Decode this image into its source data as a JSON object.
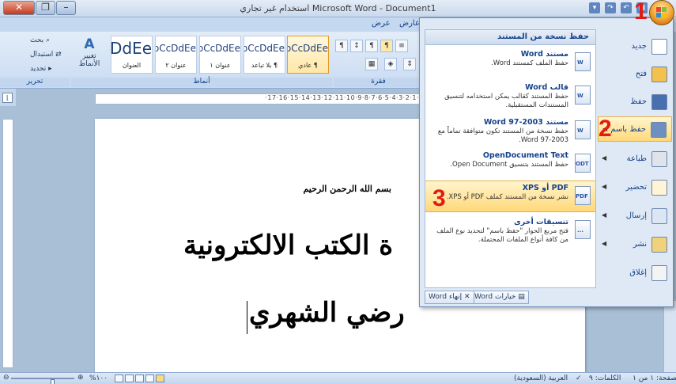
{
  "window": {
    "title": "Microsoft Word - Document1 استخدام غير تجاري"
  },
  "tabs": [
    {
      "label": "عرض"
    },
    {
      "label": "عارض"
    }
  ],
  "ribbon": {
    "styles": [
      {
        "sample": "AaBbCcDdEe",
        "name": "¶ عادي"
      },
      {
        "sample": "AaBbCcDdEe",
        "name": "¶ بلا تباعد"
      },
      {
        "sample": "AaBbCcDdEe",
        "name": "عنوان ١"
      },
      {
        "sample": "AaBbCcDdEe",
        "name": "عنوان ٢"
      },
      {
        "sample": "AaBbCcDdEe",
        "name": "العنوان"
      }
    ],
    "change_styles": "تغيير الأنماط",
    "editing": {
      "find": "بحث",
      "replace": "استبدال",
      "select": "تحديد"
    },
    "groups": {
      "styles": "أنماط",
      "editing": "تحرير",
      "paragraph": "فقرة"
    }
  },
  "ruler": "·1·2·3·4·5·6·7·8·9·10·11·12·13·14·15·16·17·",
  "document": {
    "bismillah": "بسم الله الرحمن الرحيم",
    "title": "ة الكتب الالكترونية",
    "author": "رضي الشهري"
  },
  "office_menu": {
    "submenu_header": "حفظ نسخة من المستند",
    "save_as_items": [
      {
        "title": "مستند Word",
        "desc": "حفظ الملف كمستند Word.",
        "icon": "W"
      },
      {
        "title": "قالب Word",
        "desc": "حفظ المستند كقالب يمكن استخدامه لتنسيق المستندات المستقبلية.",
        "icon": "W"
      },
      {
        "title": "مستند Word 97-2003",
        "desc": "حفظ نسخة من المستند تكون متوافقة تماماً مع Word 97-2003.",
        "icon": "W"
      },
      {
        "title": "OpenDocument Text",
        "desc": "حفظ المستند بتنسيق Open Document.",
        "icon": "ODT"
      },
      {
        "title": "PDF أو XPS",
        "desc": "نشر نسخة من المستند كملف PDF أو XPS.",
        "icon": "PDF"
      },
      {
        "title": "تنسيقات أخرى",
        "desc": "فتح مربع الحوار \"حفظ باسم\" لتحديد نوع الملف من كافة أنواع الملفات المحتملة.",
        "icon": "..."
      }
    ],
    "commands": [
      {
        "label": "جديد"
      },
      {
        "label": "فتح"
      },
      {
        "label": "حفظ"
      },
      {
        "label": "حفظ باسم"
      },
      {
        "label": "طباعة"
      },
      {
        "label": "تحضير"
      },
      {
        "label": "إرسال"
      },
      {
        "label": "نشر"
      },
      {
        "label": "إغلاق"
      }
    ],
    "word_options": "خيارات Word",
    "exit_word": "إنهاء Word"
  },
  "annotations": {
    "one": "1",
    "two": "2",
    "three": "3"
  },
  "statusbar": {
    "page": "الصفحة: ١ من ١",
    "words": "الكلمات: ٩",
    "language": "العربية (السعودية)",
    "zoom": "١٠٠%"
  },
  "colors": {
    "accent": "#15428b",
    "highlight": "#ffd87a",
    "annotation": "#e11b10"
  }
}
